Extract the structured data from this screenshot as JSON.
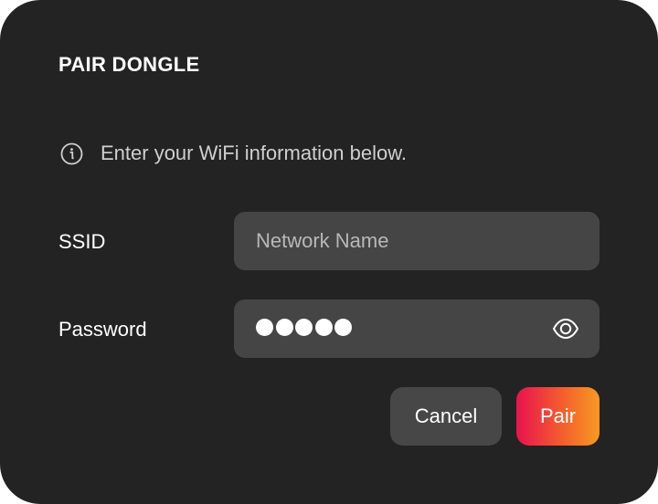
{
  "dialog": {
    "title": "PAIR DONGLE",
    "info": {
      "icon": "info-circle-icon",
      "text": "Enter your WiFi information below."
    },
    "fields": {
      "ssid": {
        "label": "SSID",
        "value": "",
        "placeholder": "Network Name"
      },
      "password": {
        "label": "Password",
        "masked_length": 5,
        "visibility_icon": "eye-icon"
      }
    },
    "buttons": {
      "cancel_label": "Cancel",
      "pair_label": "Pair"
    }
  },
  "colors": {
    "dialog_background": "#232323",
    "input_background": "#454545",
    "cancel_background": "#474747",
    "pair_gradient_start": "#e8134e",
    "pair_gradient_end": "#f79a22"
  }
}
